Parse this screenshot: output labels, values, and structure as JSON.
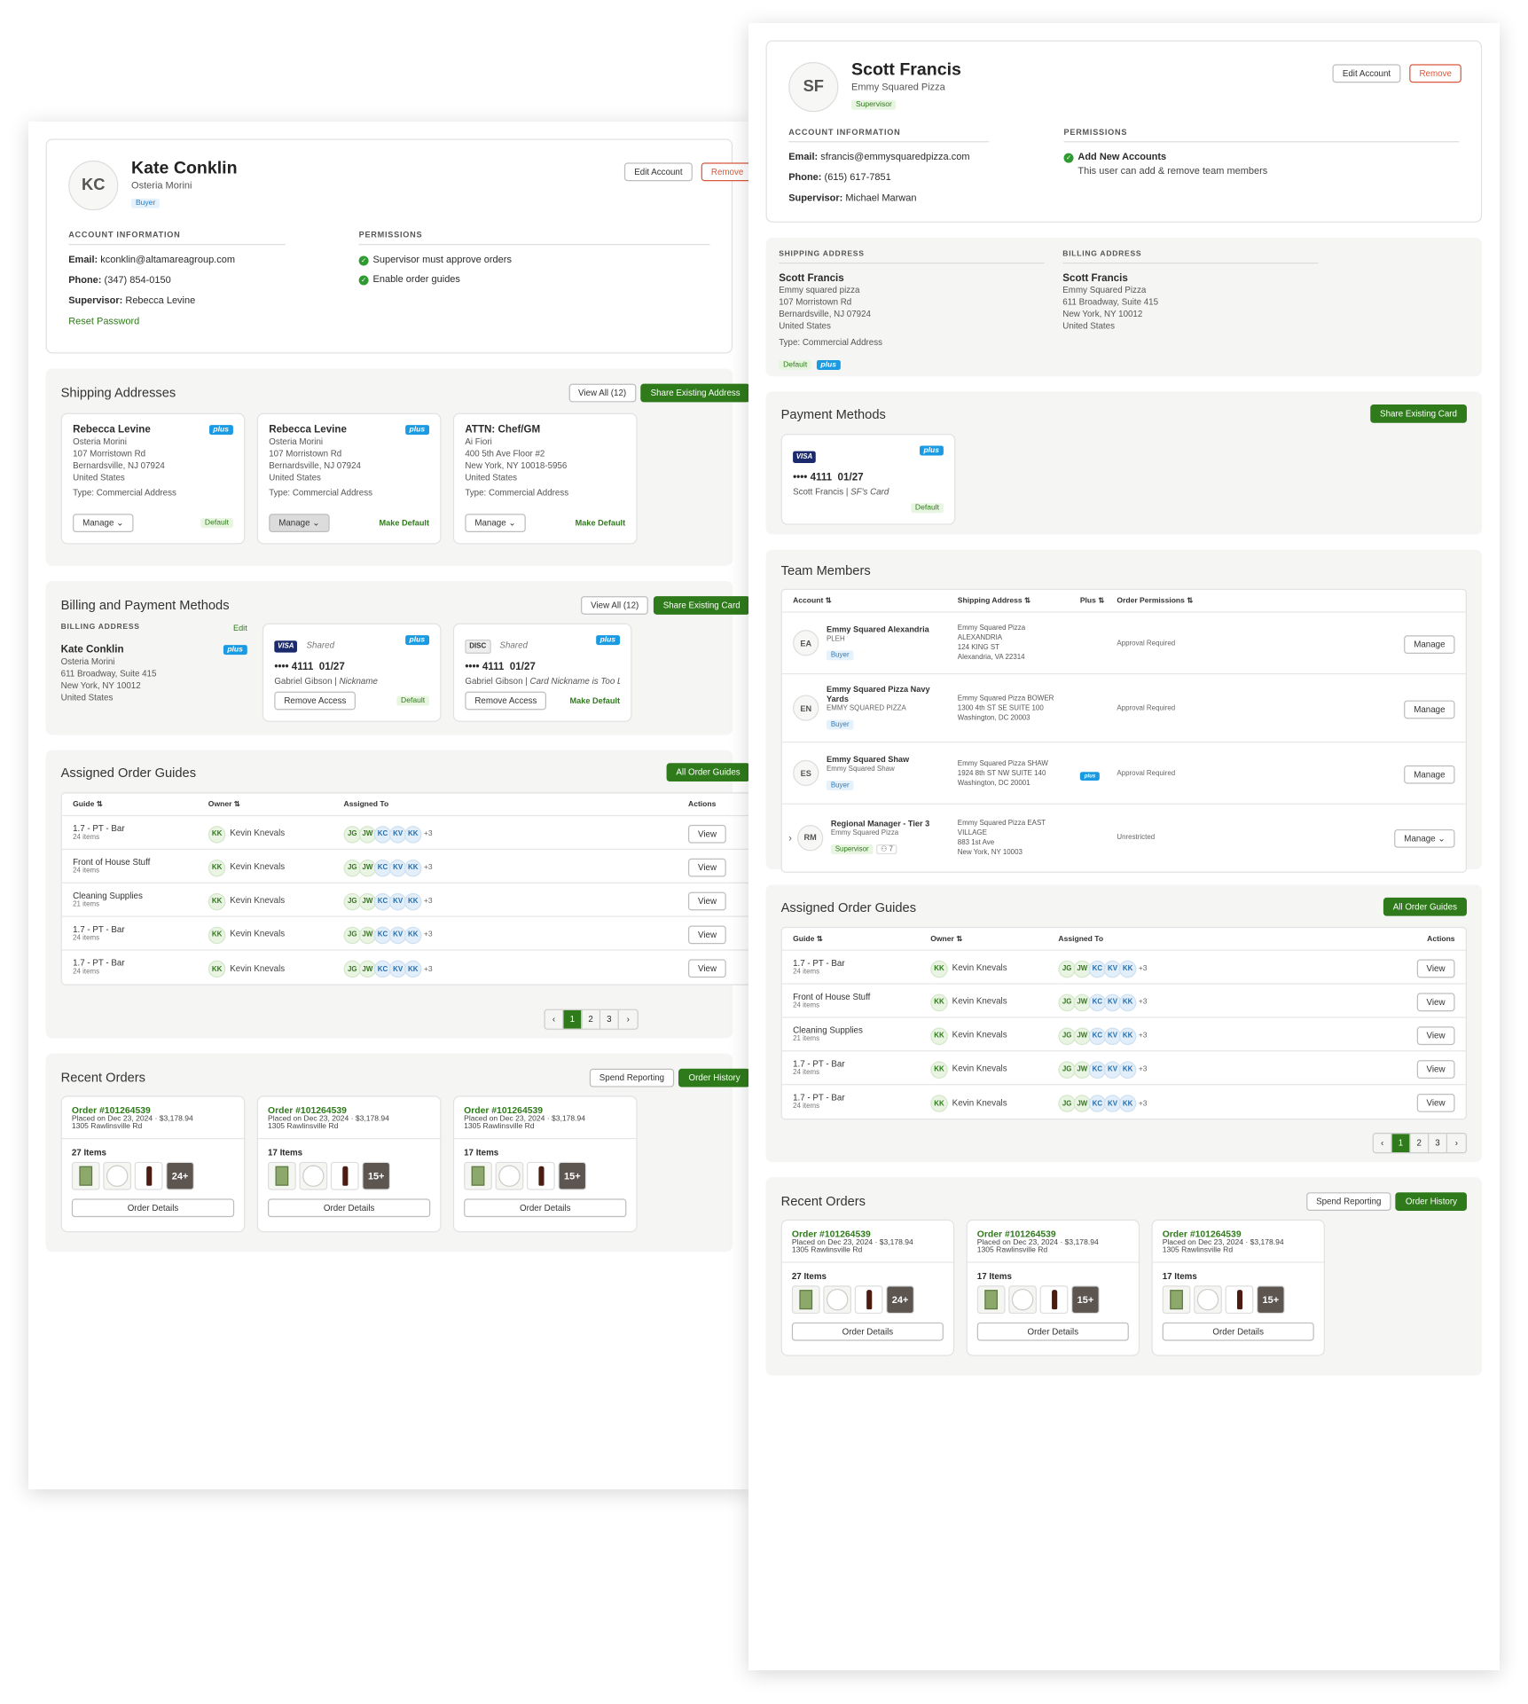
{
  "left": {
    "profile": {
      "initials": "KC",
      "name": "Kate Conklin",
      "company": "Osteria Morini",
      "role": "Buyer",
      "edit": "Edit Account",
      "remove": "Remove"
    },
    "account": {
      "header": "ACCOUNT INFORMATION",
      "email_label": "Email:",
      "email": "kconklin@altamareagroup.com",
      "phone_label": "Phone:",
      "phone": "(347) 854-0150",
      "supervisor_label": "Supervisor:",
      "supervisor": "Rebecca Levine",
      "reset": "Reset Password"
    },
    "permissions": {
      "header": "PERMISSIONS",
      "items": [
        "Supervisor must approve orders",
        "Enable order guides"
      ]
    },
    "shipping": {
      "title": "Shipping Addresses",
      "view_all": "View All (12)",
      "share": "Share Existing Address",
      "cards": [
        {
          "name": "Rebecca Levine",
          "l1": "Osteria Morini",
          "l2": "107 Morristown Rd",
          "l3": "Bernardsville, NJ 07924",
          "l4": "United States",
          "type": "Type: Commercial Address",
          "manage": "Manage",
          "status": "Default"
        },
        {
          "name": "Rebecca Levine",
          "l1": "Osteria Morini",
          "l2": "107 Morristown Rd",
          "l3": "Bernardsville, NJ 07924",
          "l4": "United States",
          "type": "Type: Commercial Address",
          "manage": "Manage",
          "status": "Make Default"
        },
        {
          "name": "ATTN: Chef/GM",
          "l1": "Ai Fiori",
          "l2": "400 5th Ave Floor #2",
          "l3": "New York, NY 10018-5956",
          "l4": "United States",
          "type": "Type: Commercial Address",
          "manage": "Manage",
          "status": "Make Default"
        }
      ]
    },
    "billing": {
      "title": "Billing and Payment Methods",
      "view_all": "View All (12)",
      "share": "Share Existing Card",
      "addr_header": "BILLING ADDRESS",
      "edit": "Edit",
      "name": "Kate Conklin",
      "l1": "Osteria Morini",
      "l2": "611 Broadway, Suite 415",
      "l3": "New York, NY 10012",
      "l4": "United States",
      "cards": [
        {
          "brand": "VISA",
          "shared": "Shared",
          "number": "•••• 4111  01/27",
          "owner": "Gabriel Gibson",
          "nick": "Nickname",
          "remove": "Remove Access",
          "status": "Default"
        },
        {
          "brand": "DISC",
          "shared": "Shared",
          "number": "•••• 4111  01/27",
          "owner": "Gabriel Gibson",
          "nick": "Card Nickname is Too Long",
          "remove": "Remove Access",
          "status": "Make Default"
        }
      ]
    },
    "guides": {
      "title": "Assigned Order Guides",
      "all": "All Order Guides",
      "cols": [
        "Guide ⇅",
        "Owner ⇅",
        "Assigned To",
        "Actions"
      ],
      "rows": [
        {
          "name": "1.7 - PT - Bar",
          "count": "24 items"
        },
        {
          "name": "Front of House Stuff",
          "count": "24 items"
        },
        {
          "name": "Cleaning Supplies",
          "count": "21 items"
        },
        {
          "name": "1.7 - PT - Bar",
          "count": "24 items"
        },
        {
          "name": "1.7 - PT - Bar",
          "count": "24 items"
        }
      ],
      "owner_init": "KK",
      "owner": "Kevin Knevals",
      "assignees": [
        "JG",
        "JW",
        "KC",
        "KV",
        "KK"
      ],
      "extra": "+3",
      "view": "View",
      "pages": [
        "‹",
        "1",
        "2",
        "3",
        "›"
      ]
    },
    "orders": {
      "title": "Recent Orders",
      "spend": "Spend Reporting",
      "history": "Order History",
      "cards": [
        {
          "id": "Order #101264539",
          "placed": "Placed on Dec 23, 2024 · $3,178.94",
          "addr": "1305 Rawlinsville Rd",
          "items": "27 Items",
          "more": "24+",
          "details": "Order Details"
        },
        {
          "id": "Order #101264539",
          "placed": "Placed on Dec 23, 2024 · $3,178.94",
          "addr": "1305 Rawlinsville Rd",
          "items": "17 Items",
          "more": "15+",
          "details": "Order Details"
        },
        {
          "id": "Order #101264539",
          "placed": "Placed on Dec 23, 2024 · $3,178.94",
          "addr": "1305 Rawlinsville Rd",
          "items": "17 Items",
          "more": "15+",
          "details": "Order Details"
        }
      ]
    }
  },
  "right": {
    "profile": {
      "initials": "SF",
      "name": "Scott Francis",
      "company": "Emmy Squared Pizza",
      "role": "Supervisor",
      "edit": "Edit Account",
      "remove": "Remove"
    },
    "account": {
      "header": "ACCOUNT INFORMATION",
      "email_label": "Email:",
      "email": "sfrancis@emmysquaredpizza.com",
      "phone_label": "Phone:",
      "phone": "(615) 617-7851",
      "supervisor_label": "Supervisor:",
      "supervisor": "Michael Marwan"
    },
    "permissions": {
      "header": "PERMISSIONS",
      "title": "Add New Accounts",
      "desc": "This user can add & remove team members"
    },
    "shipping": {
      "header": "SHIPPING ADDRESS",
      "name": "Scott Francis",
      "l1": "Emmy squared pizza",
      "l2": "107 Morristown Rd",
      "l3": "Bernardsville, NJ 07924",
      "l4": "United States",
      "type": "Type: Commercial Address",
      "default": "Default",
      "plus": "plus"
    },
    "billing": {
      "header": "BILLING ADDRESS",
      "name": "Scott Francis",
      "l1": "Emmy Squared Pizza",
      "l2": "611 Broadway, Suite 415",
      "l3": "New York, NY 10012",
      "l4": "United States"
    },
    "payment": {
      "title": "Payment Methods",
      "share": "Share Existing Card",
      "brand": "VISA",
      "number": "•••• 4111  01/27",
      "owner": "Scott Francis",
      "nick": "SF's Card",
      "status": "Default"
    },
    "team": {
      "title": "Team Members",
      "cols": [
        "Account ⇅",
        "Shipping Address ⇅",
        "Plus ⇅",
        "Order Permissions ⇅"
      ],
      "rows": [
        {
          "init": "EA",
          "name": "Emmy Squared Alexandria",
          "sub": "PLEH",
          "role": "Buyer",
          "a1": "Emmy Squared Pizza",
          "a2": "ALEXANDRIA",
          "a3": "124 KING ST",
          "a4": "Alexandria, VA 22314",
          "plus": false,
          "perm": "Approval Required",
          "manage": "Manage"
        },
        {
          "init": "EN",
          "name": "Emmy Squared Pizza Navy Yards",
          "sub": "EMMY SQUARED PIZZA",
          "role": "Buyer",
          "a1": "Emmy Squared Pizza BOWER",
          "a2": "1300 4th ST SE SUITE 100",
          "a3": "Washington, DC 20003",
          "a4": "",
          "plus": false,
          "perm": "Approval Required",
          "manage": "Manage"
        },
        {
          "init": "ES",
          "name": "Emmy Squared Shaw",
          "sub": "Emmy Squared Shaw",
          "role": "Buyer",
          "a1": "Emmy Squared Pizza SHAW",
          "a2": "1924 8th ST NW SUITE 140",
          "a3": "Washington, DC 20001",
          "a4": "",
          "plus": true,
          "perm": "Approval Required",
          "manage": "Manage"
        },
        {
          "init": "RM",
          "name": "Regional Manager - Tier 3",
          "sub": "Emmy Squared Pizza",
          "role": "Supervisor",
          "count": "7",
          "a1": "Emmy Squared Pizza EAST",
          "a2": "VILLAGE",
          "a3": "883 1st Ave",
          "a4": "New York, NY 10003",
          "plus": false,
          "perm": "Unrestricted",
          "manage": "Manage"
        }
      ]
    },
    "guides": {
      "title": "Assigned Order Guides",
      "all": "All Order Guides",
      "cols": [
        "Guide ⇅",
        "Owner ⇅",
        "Assigned To",
        "Actions"
      ],
      "rows": [
        {
          "name": "1.7 - PT - Bar",
          "count": "24 items"
        },
        {
          "name": "Front of House Stuff",
          "count": "24 items"
        },
        {
          "name": "Cleaning Supplies",
          "count": "21 items"
        },
        {
          "name": "1.7 - PT - Bar",
          "count": "24 items"
        },
        {
          "name": "1.7 - PT - Bar",
          "count": "24 items"
        }
      ],
      "owner_init": "KK",
      "owner": "Kevin Knevals",
      "assignees": [
        "JG",
        "JW",
        "KC",
        "KV",
        "KK"
      ],
      "extra": "+3",
      "view": "View",
      "pages": [
        "‹",
        "1",
        "2",
        "3",
        "›"
      ]
    },
    "orders": {
      "title": "Recent Orders",
      "spend": "Spend Reporting",
      "history": "Order History",
      "cards": [
        {
          "id": "Order #101264539",
          "placed": "Placed on Dec 23, 2024 · $3,178.94",
          "addr": "1305 Rawlinsville Rd",
          "items": "27 Items",
          "more": "24+",
          "details": "Order Details"
        },
        {
          "id": "Order #101264539",
          "placed": "Placed on Dec 23, 2024 · $3,178.94",
          "addr": "1305 Rawlinsville Rd",
          "items": "17 Items",
          "more": "15+",
          "details": "Order Details"
        },
        {
          "id": "Order #101264539",
          "placed": "Placed on Dec 23, 2024 · $3,178.94",
          "addr": "1305 Rawlinsville Rd",
          "items": "17 Items",
          "more": "15+",
          "details": "Order Details"
        }
      ]
    }
  }
}
